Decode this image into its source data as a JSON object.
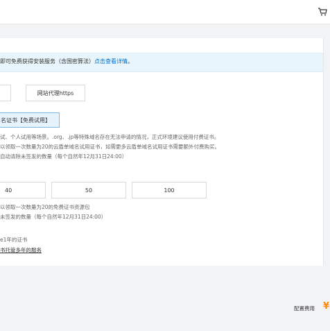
{
  "header": {
    "cart_icon": "cart-icon"
  },
  "notice": {
    "text": "即可免费获得安装服务（含国密算法）",
    "link": "点击查看详情",
    "suffix": "。"
  },
  "service_options": [
    {
      "label": ""
    },
    {
      "label": "网站代理https"
    }
  ],
  "selected_cert": {
    "label": "名证书【免费试用】"
  },
  "notes": [
    "试、个人试用等场景。.org、.jp等特殊域名存在无法申请的情况，正式环境建议使用付费证书。",
    "以领取一次数量为20的云盾单域名试用证书，如需更多云盾单域名试用证书需要额外付费购买。",
    "自动清除未签发的数量（每个自然年12月31日24:00）"
  ],
  "quantity_options": [
    "40",
    "50",
    "100"
  ],
  "package_notes": [
    "以领取一次数量为20的免费证书资源包",
    "未签发的数量（每个自然年12月31日24:00）"
  ],
  "cert_year_note": "e1年的证书",
  "hosting_link": "书托管多年的服务",
  "footer": {
    "label": "配置费用",
    "currency": "¥",
    "accent": "#ff8a00"
  }
}
